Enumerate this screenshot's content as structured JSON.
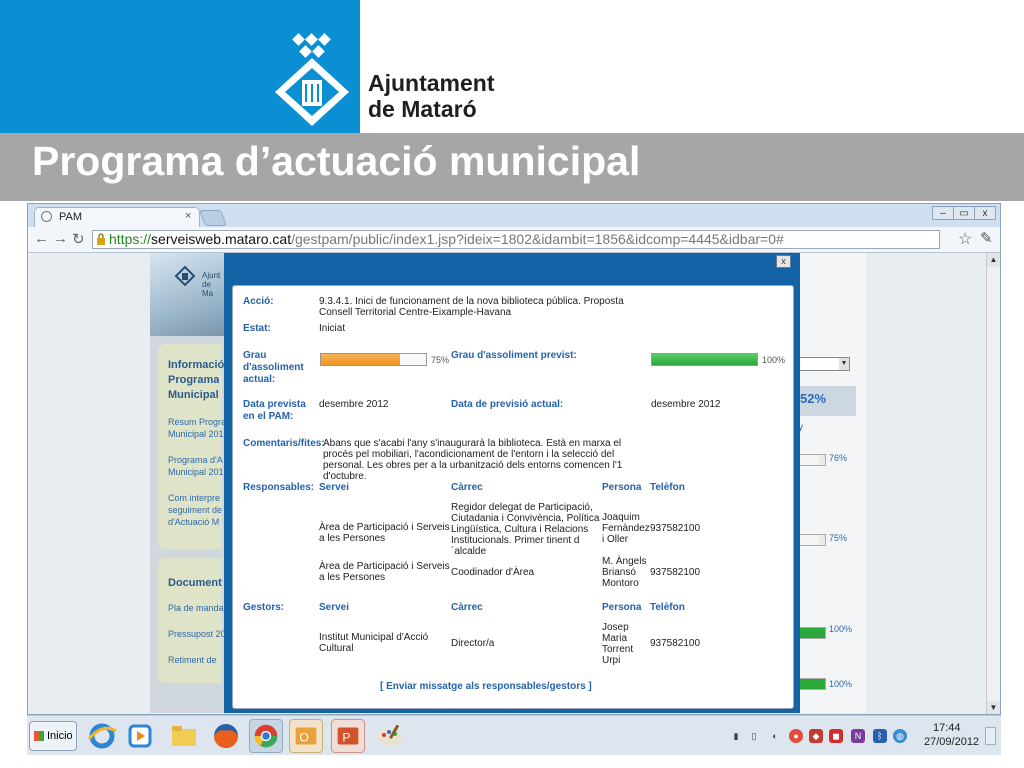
{
  "slide": {
    "org_line1": "Ajuntament",
    "org_line2": "de Mataró",
    "title": "Programa d’actuació municipal"
  },
  "browser": {
    "tab_title": "PAM",
    "tab_close": "×",
    "url_scheme": "https://",
    "url_host": "serveisweb.mataro.cat",
    "url_path": "/gestpam/public/index1.jsp?ideix=1802&idambit=1856&idcomp=4445&idbar=0#",
    "win_minimize": "–",
    "win_maximize": "▭",
    "win_close": "x"
  },
  "page": {
    "logo_line1": "Ajunt",
    "logo_line2": "de Ma",
    "info_title_1": "Informació",
    "info_title_2": "Programa",
    "info_title_3": "Municipal",
    "info_link_1a": "Resum Progra",
    "info_link_1b": "Municipal 201",
    "info_link_2a": "Programa d'A",
    "info_link_2b": "Municipal 201",
    "info_link_3a": "Com interpre",
    "info_link_3b": "seguiment de",
    "info_link_3c": "d'Actuació M",
    "docs_title": "Document",
    "docs_link_1": "Pla de manda",
    "docs_link_2": "Pressupost 20",
    "docs_link_3": "Retiment de",
    "right_big_value": "52%",
    "right_label": "y",
    "right_pcts": [
      "76%",
      "75%",
      "100%",
      "100%"
    ],
    "right_fills": [
      0.76,
      0.75,
      1.0,
      1.0
    ]
  },
  "modal": {
    "close_label": "x",
    "accio_label": "Acció:",
    "accio_value": "9.3.4.1. Inici de funcionament de la nova biblioteca pública. Proposta Consell Territorial Centre-Eixample-Havana",
    "estat_label": "Estat:",
    "estat_value": "Iniciat",
    "grau_label": "Grau d'assoliment actual:",
    "grau_value": 0.75,
    "grau_pct": "75%",
    "grau_previst_label": "Grau d'assoliment previst:",
    "grau_previst_value": 1.0,
    "grau_previst_pct": "100%",
    "data_prevista_label": "Data prevista en el PAM:",
    "data_prevista_value": "desembre 2012",
    "data_previsio_label": "Data de previsió actual:",
    "data_previsio_value": "desembre 2012",
    "comentaris_label": "Comentaris/fites:",
    "comentaris_value": "Abans que s'acabi l'any s'inaugurarà la biblioteca. Està en marxa el procés pel mobiliari, l'acondicionament de l'entorn i la selecció del personal. Les obres per a la urbanització dels entorns comencen l'1 d'octubre.",
    "responsables_label": "Responsables:",
    "gestors_label": "Gestors:",
    "col_servei": "Servei",
    "col_carrec": "Càrrec",
    "col_persona": "Persona",
    "col_telefon": "Telèfon",
    "responsables": [
      {
        "servei": "Àrea de Participació i Serveis a les Persones",
        "carrec": "Regidor delegat de Participació, Ciutadania i Convivència, Política Lingüística, Cultura i Relacions Institucionals. Primer tinent d ´alcalde",
        "persona": "Joaquim Fernàndez i Oller",
        "telefon": "937582100"
      },
      {
        "servei": "Àrea de Participació i Serveis a les Persones",
        "carrec": "Coodinador d'Àrea",
        "persona": "M. Àngels Briansó Montoro",
        "telefon": "937582100"
      }
    ],
    "gestors": [
      {
        "servei": "Institut Municipal d'Acció Cultural",
        "carrec": "Director/a",
        "persona": "Josep Maria Torrent Urpi",
        "telefon": "937582100"
      }
    ],
    "send_link": "[ Enviar missatge als responsables/gestors ]"
  },
  "taskbar": {
    "start_label": "Inicio",
    "clock_time": "17:44",
    "clock_date": "27/09/2012"
  },
  "colors": {
    "brand_blue": "#0a8fd3",
    "title_band": "#a6a6a6",
    "modal_blue": "#1563a7",
    "progress_orange": "#f0941f",
    "progress_green": "#2aa83a",
    "label_blue": "#2562ad"
  }
}
